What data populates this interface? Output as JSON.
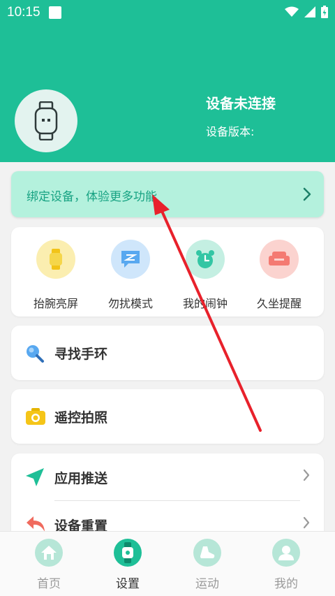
{
  "status_bar": {
    "time": "10:15"
  },
  "device": {
    "status": "设备未连接",
    "version_label": "设备版本:"
  },
  "bind_banner": {
    "label": "绑定设备，体验更多功能"
  },
  "quick_actions": [
    {
      "label": "抬腕亮屏",
      "icon": "watch-icon",
      "color": "#f5d64a"
    },
    {
      "label": "勿扰模式",
      "icon": "message-icon",
      "color": "#58a8f0"
    },
    {
      "label": "我的闹钟",
      "icon": "alarm-clock-icon",
      "color": "#33c6a4"
    },
    {
      "label": "久坐提醒",
      "icon": "sofa-icon",
      "color": "#f47a72"
    }
  ],
  "find_band": {
    "label": "寻找手环",
    "icon": "search-icon"
  },
  "remote_camera": {
    "label": "遥控拍照",
    "icon": "camera-icon"
  },
  "settings_list": [
    {
      "label": "应用推送",
      "icon": "send-icon"
    },
    {
      "label": "设备重置",
      "icon": "reset-icon"
    }
  ],
  "tabs": [
    {
      "label": "首页",
      "icon": "home-icon",
      "active": false
    },
    {
      "label": "设置",
      "icon": "watch-icon",
      "active": true
    },
    {
      "label": "运动",
      "icon": "shoe-icon",
      "active": false
    },
    {
      "label": "我的",
      "icon": "user-icon",
      "active": false
    }
  ],
  "colors": {
    "primary": "#1ebf97",
    "banner": "#b4f1dd",
    "annotation_arrow": "#e8212b"
  }
}
